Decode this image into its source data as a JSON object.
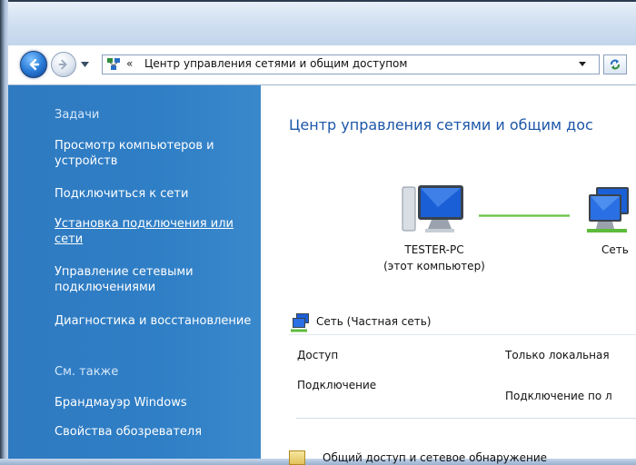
{
  "navigation": {
    "back_label": "Назад",
    "forward_label": "Вперёд"
  },
  "address_bar": {
    "chevron": "«",
    "path": "Центр управления сетями и общим доступом"
  },
  "sidebar": {
    "tasks_header": "Задачи",
    "items": [
      {
        "label": "Просмотр компьютеров и устройств"
      },
      {
        "label": "Подключиться к сети"
      },
      {
        "label": "Установка подключения или сети"
      },
      {
        "label": "Управление сетевыми подключениями"
      },
      {
        "label": "Диагностика и восстановление"
      }
    ],
    "see_also_header": "См. также",
    "see_also": [
      {
        "label": "Брандмауэр Windows"
      },
      {
        "label": "Свойства обозревателя"
      }
    ]
  },
  "main": {
    "title": "Центр управления сетями и общим дос",
    "computer": {
      "name": "TESTER-PC",
      "sub": "(этот компьютер)"
    },
    "network_icon_label": "Сеть",
    "network": {
      "name": "Сеть (Частная сеть)",
      "properties": [
        {
          "label": "Доступ",
          "value": "Только локальная"
        },
        {
          "label": "Подключение",
          "value": "Подключение по л"
        }
      ]
    },
    "sharing_section": "Общий доступ и сетевое обнаружение"
  },
  "colors": {
    "sidebar_bg": "#2f7ac1",
    "title_blue": "#1c56a8",
    "link_green": "#5dbb3a"
  },
  "icons": {
    "back": "arrow-left-icon",
    "forward": "arrow-right-icon",
    "address": "network-center-icon",
    "refresh": "refresh-icon",
    "computer": "computer-icon",
    "network": "network-icon",
    "share": "sharing-icon"
  }
}
